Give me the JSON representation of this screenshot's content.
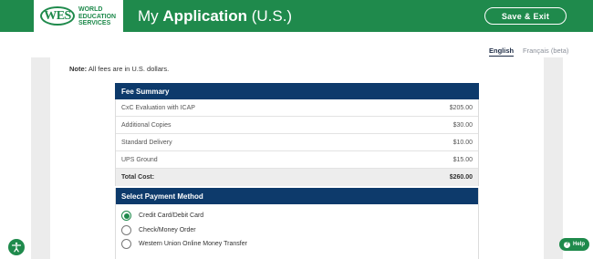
{
  "header": {
    "logo_mark": "WES",
    "logo_text": [
      "WORLD",
      "EDUCATION",
      "SERVICES"
    ],
    "title_prefix": "My",
    "title_bold": "Application",
    "title_suffix": "(U.S.)",
    "save_exit_label": "Save & Exit",
    "brand_color": "#1f8a4c"
  },
  "language": {
    "english": "English",
    "french": "Français (beta)"
  },
  "note": {
    "label": "Note:",
    "text": "All fees are in U.S. dollars."
  },
  "fee_summary": {
    "title": "Fee Summary",
    "items": [
      {
        "label": "CxC Evaluation with ICAP",
        "amount": "$205.00"
      },
      {
        "label": "Additional Copies",
        "amount": "$30.00"
      },
      {
        "label": "Standard Delivery",
        "amount": "$10.00"
      },
      {
        "label": "UPS Ground",
        "amount": "$15.00"
      }
    ],
    "total_label": "Total Cost:",
    "total_amount": "$260.00",
    "header_color": "#0d3a6b"
  },
  "payment": {
    "title": "Select Payment Method",
    "options": [
      {
        "label": "Credit Card/Debit Card",
        "checked": true
      },
      {
        "label": "Check/Money Order",
        "checked": false
      },
      {
        "label": "Western Union Online Money Transfer",
        "checked": false
      }
    ]
  },
  "widgets": {
    "accessibility_icon": "accessibility-icon",
    "help_label": "Help"
  }
}
